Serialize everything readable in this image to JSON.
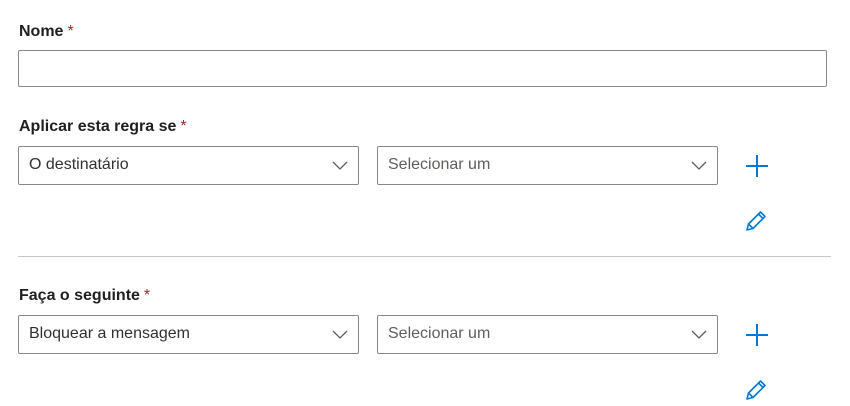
{
  "form": {
    "name_field": {
      "label": "Nome",
      "required_mark": "*",
      "value": ""
    },
    "condition": {
      "label": "Aplicar esta regra se",
      "required_mark": "*",
      "first_dropdown": "O destinatário",
      "second_dropdown": "Selecionar um"
    },
    "action": {
      "label": "Faça o seguinte",
      "required_mark": "*",
      "first_dropdown": "Bloquear a mensagem",
      "second_dropdown": "Selecionar um"
    }
  },
  "icons": {
    "add": "plus-icon",
    "edit": "pencil-icon",
    "dropdown": "chevron-down-icon"
  },
  "colors": {
    "accent": "#0078d4",
    "required": "#a4262c",
    "warning": "#d87b00",
    "border": "#8a8886"
  }
}
